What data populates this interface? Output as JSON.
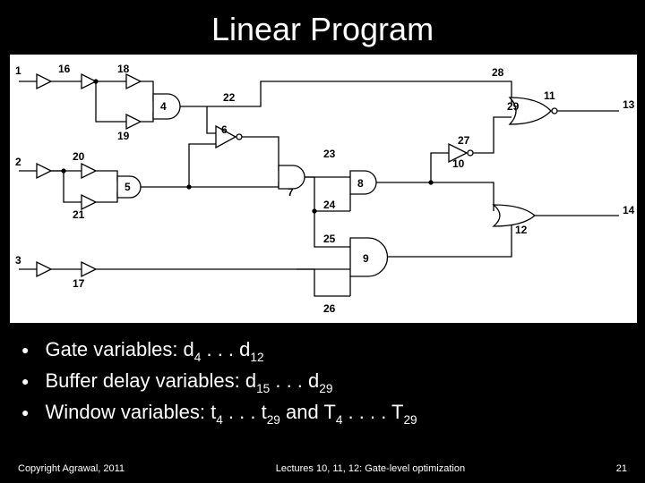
{
  "title": "Linear Program",
  "bullets": {
    "b1_pre": "Gate variables: d",
    "b1_s1": "4",
    "b1_mid": " . . . d",
    "b1_s2": "12",
    "b2_pre": "Buffer delay variables: d",
    "b2_s1": "15",
    "b2_mid": " . . . d",
    "b2_s2": "29",
    "b3_pre": "Window variables: t",
    "b3_s1": "4",
    "b3_mid1": " . . . t",
    "b3_s2": "29",
    "b3_mid2": " and T",
    "b3_s3": "4",
    "b3_mid3": " . . . . T",
    "b3_s4": "29"
  },
  "footer": {
    "left": "Copyright Agrawal, 2011",
    "center": "Lectures 10, 11, 12: Gate-level optimization",
    "right": "21"
  },
  "circuit": {
    "inputs": [
      "1",
      "2",
      "3"
    ],
    "buffers_top": [
      "16",
      "18",
      "19",
      "20",
      "21",
      "17"
    ],
    "wires_mid": [
      "22",
      "23",
      "24",
      "25",
      "26",
      "27",
      "28",
      "29"
    ],
    "gates": [
      "4",
      "5",
      "6",
      "7",
      "8",
      "9",
      "10",
      "11",
      "12"
    ],
    "outputs": [
      "13",
      "14"
    ]
  }
}
